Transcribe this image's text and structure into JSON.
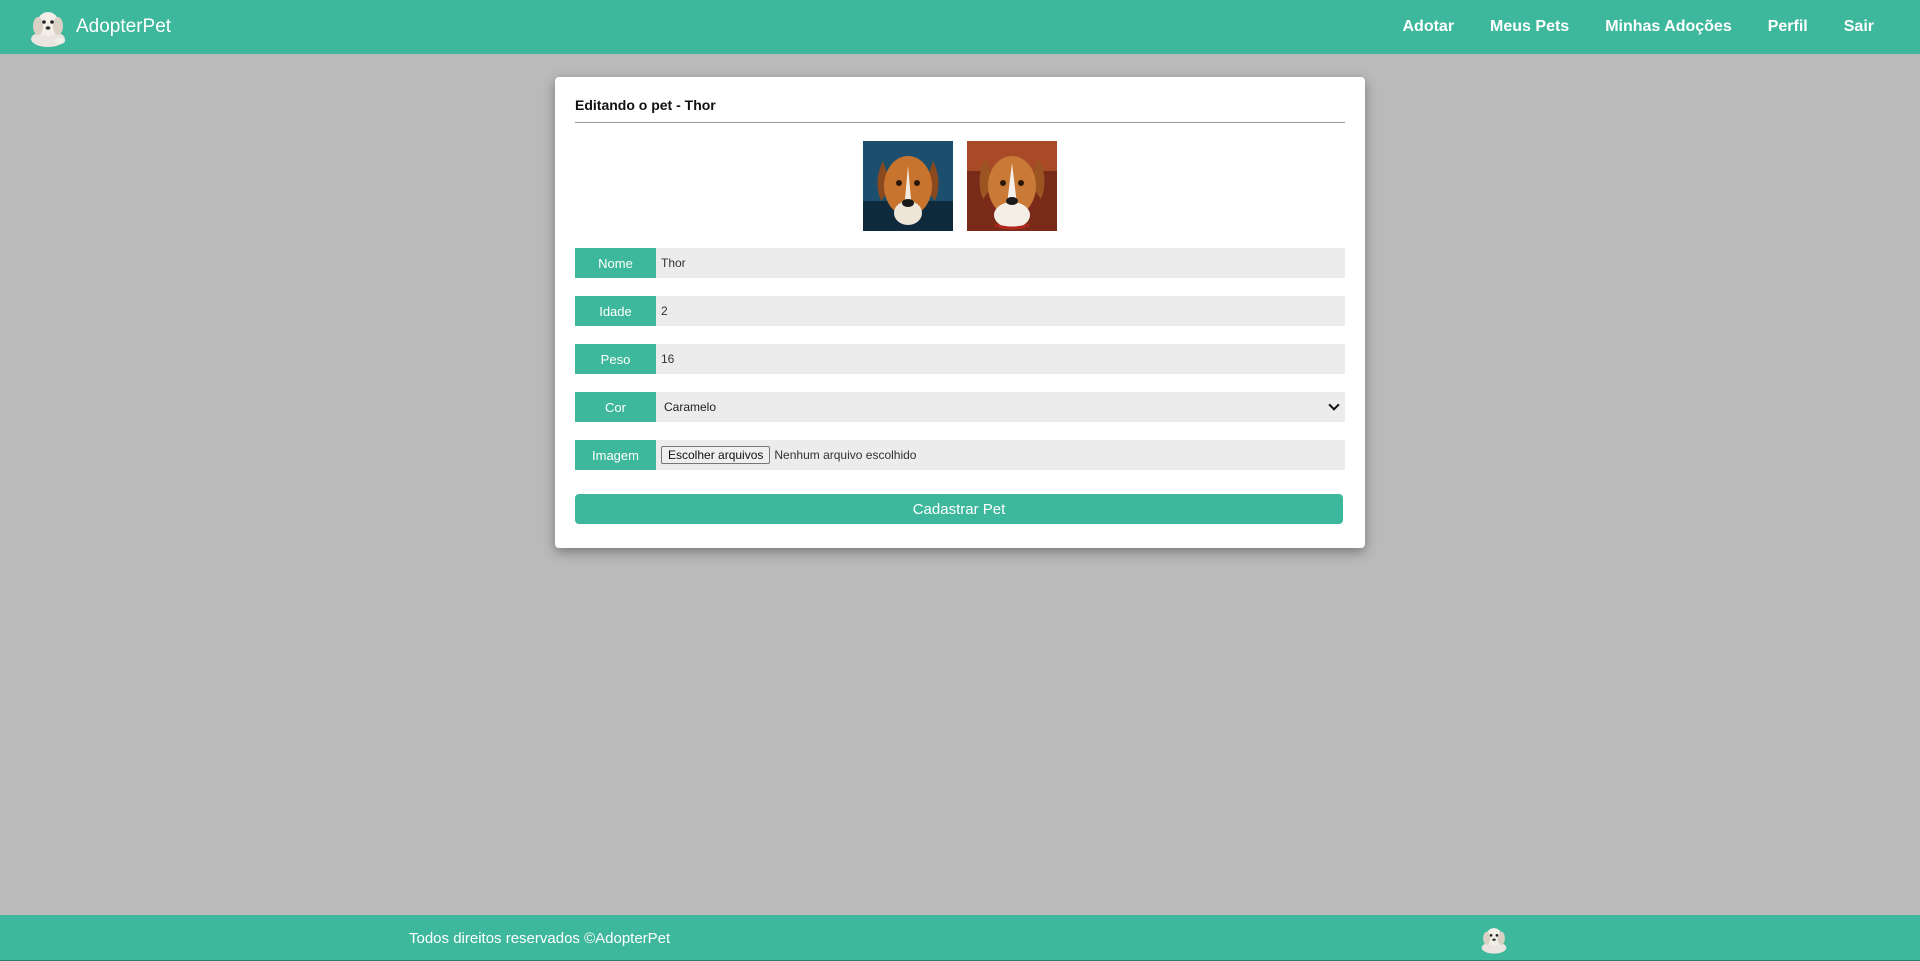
{
  "header": {
    "brand": "AdopterPet",
    "nav": [
      "Adotar",
      "Meus Pets",
      "Minhas Adoções",
      "Perfil",
      "Sair"
    ]
  },
  "form": {
    "title": "Editando o pet - Thor",
    "fields": {
      "nome": {
        "label": "Nome",
        "value": "Thor"
      },
      "idade": {
        "label": "Idade",
        "value": "2"
      },
      "peso": {
        "label": "Peso",
        "value": "16"
      },
      "cor": {
        "label": "Cor",
        "value": "Caramelo"
      },
      "imagem": {
        "label": "Imagem",
        "button": "Escolher arquivos",
        "status": "Nenhum arquivo escolhido"
      }
    },
    "submit": "Cadastrar Pet"
  },
  "footer": {
    "text": "Todos direitos reservados ©AdopterPet"
  },
  "colors": {
    "accent": "#3db89c",
    "background": "#bababa",
    "input_bg": "#ececec"
  },
  "icons": [
    "dog-logo-icon",
    "chevron-down-icon"
  ]
}
